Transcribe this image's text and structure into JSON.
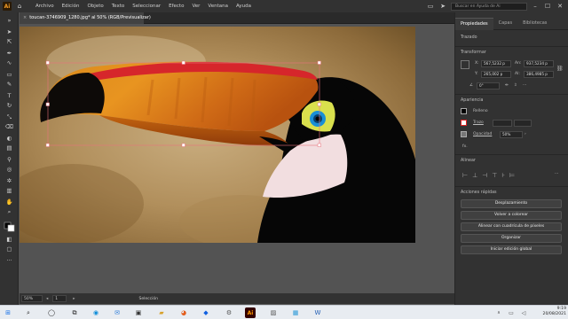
{
  "app": {
    "logo": "Ai",
    "name": "Adobe Illustrator"
  },
  "menubar": {
    "items": [
      "Archivo",
      "Edición",
      "Objeto",
      "Texto",
      "Seleccionar",
      "Efecto",
      "Ver",
      "Ventana",
      "Ayuda"
    ],
    "search_placeholder": "Buscar en Ayuda de Ai"
  },
  "document_tab": {
    "title": "toucan-3746909_1280.jpg* al 50% (RGB/Previsualizar)",
    "close": "×"
  },
  "status": {
    "zoom": "50%",
    "page": "1",
    "selection_label": "Selección"
  },
  "panel": {
    "tabs": [
      "Propiedades",
      "Capas",
      "Bibliotecas"
    ],
    "section_object": "Trazado",
    "section_transform": "Transformar",
    "transform": {
      "x_label": "X:",
      "x_value": "567,5232 p",
      "y_label": "Y:",
      "y_value": "265,002 p",
      "w_label": "An:",
      "w_value": "937,5234 p",
      "h_label": "Al:",
      "h_value": "386,4985 p",
      "angle_value": "0°"
    },
    "section_appearance": "Apariencia",
    "fill_label": "Relleno",
    "stroke_label": "Trazo",
    "opacity_label": "Opacidad",
    "opacity_value": "50%",
    "fx_label": "fx.",
    "section_align": "Alinear",
    "section_quick": "Acciones rápidas",
    "buttons": [
      "Desplazamiento",
      "Volver a colorear",
      "Alinear con cuadrícula de píxeles",
      "Organizar",
      "Iniciar edición global"
    ]
  },
  "taskbar": {
    "time": "9:19",
    "date": "20/08/2021"
  },
  "colors": {
    "accent": "#f29b25",
    "ui_dark": "#323232",
    "canvas": "#535353",
    "beak_red": "#d6262b",
    "beak_orange": "#e58a1a",
    "eye_blue": "#1a8fd6",
    "eye_ring": "#d8e54a"
  }
}
